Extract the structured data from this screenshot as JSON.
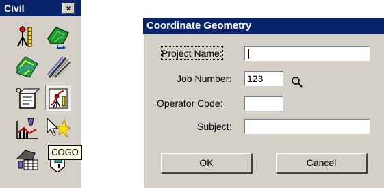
{
  "palette": {
    "title": "Civil",
    "close_symbol": "×",
    "tools": [
      "survey-station-icon",
      "terrain-model-icon",
      "contours-icon",
      "alignment-design-icon",
      "field-book-icon",
      "cogo-icon",
      "profile-icon",
      "highlight-icon",
      "cross-section-icon",
      "station-label-icon"
    ],
    "tooltip": "COGO"
  },
  "dialog": {
    "title": "Coordinate Geometry",
    "labels": {
      "project_name": "Project Name:",
      "job_number": "Job Number:",
      "operator_code": "Operator Code:",
      "subject": "Subject:"
    },
    "values": {
      "project_name": "",
      "job_number": "123",
      "operator_code": "",
      "subject": ""
    },
    "buttons": {
      "ok": "OK",
      "cancel": "Cancel"
    }
  },
  "colors": {
    "title_bar": "#0a246a",
    "face": "#d4d0c8",
    "tooltip_bg": "#ffffe1"
  }
}
